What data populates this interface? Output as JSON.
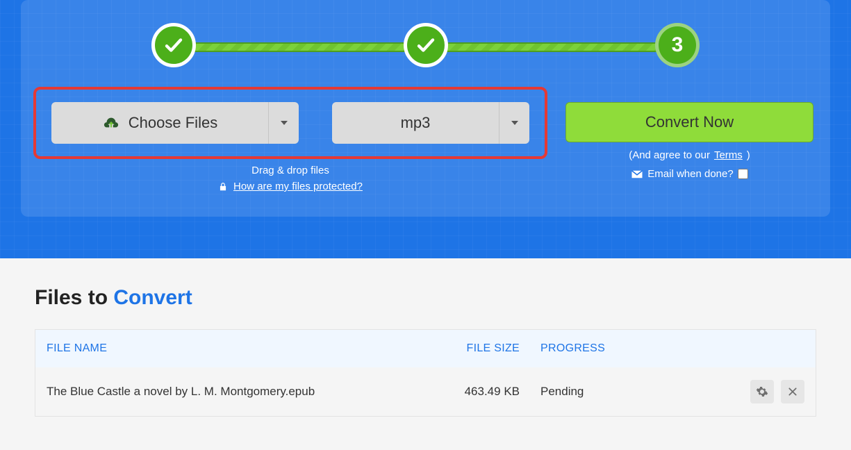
{
  "steps": {
    "step1": "done",
    "step2": "done",
    "step3_label": "3"
  },
  "controls": {
    "choose_files_label": "Choose Files",
    "format_selected": "mp3",
    "drag_drop_text": "Drag & drop files",
    "protected_link_text": "How are my files protected?"
  },
  "convert": {
    "button_label": "Convert Now",
    "agree_prefix": "(And agree to our ",
    "terms_link": "Terms",
    "agree_suffix": ")",
    "email_label": "Email when done?"
  },
  "files_section": {
    "title_prefix": "Files to ",
    "title_accent": "Convert",
    "columns": {
      "name": "FILE NAME",
      "size": "FILE SIZE",
      "progress": "PROGRESS"
    },
    "rows": [
      {
        "name": "The Blue Castle a novel by L. M. Montgomery.epub",
        "size": "463.49 KB",
        "progress": "Pending"
      }
    ]
  }
}
